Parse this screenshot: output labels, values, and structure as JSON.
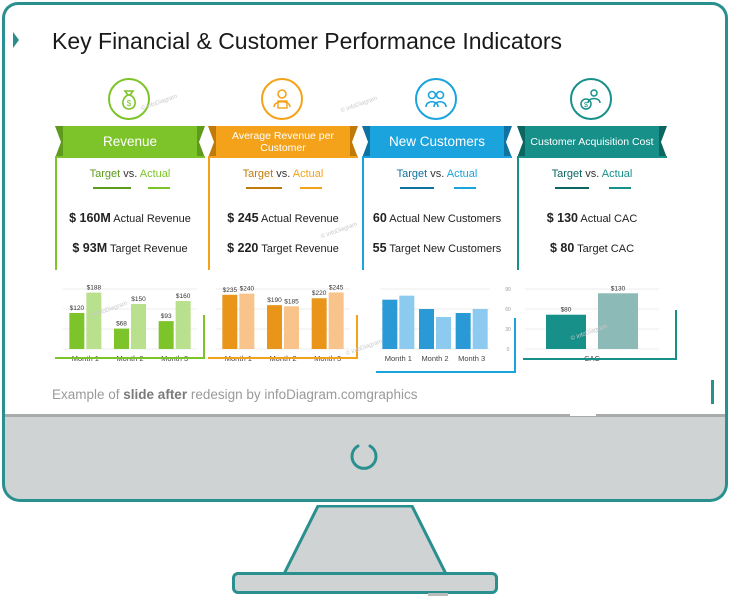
{
  "slide": {
    "title": "Key Financial & Customer Performance Indicators",
    "footer_prefix": "Example of ",
    "footer_bold": "slide after",
    "footer_suffix": " redesign by infoDiagram.com",
    "footer_tail": "graphics",
    "watermark": "© infoDiagram"
  },
  "colors": {
    "revenue": "#7dc42a",
    "arpc": "#f4a21a",
    "customers": "#1aa3dd",
    "cac": "#17908a",
    "frame": "#2a8f8f"
  },
  "columns": [
    {
      "label": "Revenue",
      "icon": "money-bag-icon",
      "target_text": "Target",
      "vs_text": "vs.",
      "actual_text": "Actual",
      "metric1_value": "$ 160M",
      "metric1_label": " Actual Revenue",
      "metric2_value": "$ 93M",
      "metric2_label": " Target  Revenue"
    },
    {
      "label": "Average Revenue per Customer",
      "icon": "customer-revenue-icon",
      "target_text": "Target",
      "vs_text": "vs.",
      "actual_text": "Actual",
      "metric1_value": "$ 245",
      "metric1_label": " Actual Revenue",
      "metric2_value": "$ 220",
      "metric2_label": " Target  Revenue"
    },
    {
      "label": "New Customers",
      "icon": "people-icon",
      "target_text": "Target",
      "vs_text": "vs.",
      "actual_text": "Actual",
      "metric1_value": "60",
      "metric1_label": " Actual New Customers",
      "metric2_value": "55",
      "metric2_label": " Target  New Customers"
    },
    {
      "label": "Customer Acquisition Cost",
      "icon": "acquisition-cost-icon",
      "target_text": "Target",
      "vs_text": "vs.",
      "actual_text": "Actual",
      "metric1_value": "$ 130",
      "metric1_label": " Actual CAC",
      "metric2_value": "$ 80",
      "metric2_label": " Target CAC"
    }
  ],
  "chart_data": [
    {
      "type": "bar",
      "categories": [
        "Month 1",
        "Month 2",
        "Month 3"
      ],
      "series": [
        {
          "values": [
            120,
            68,
            93
          ],
          "color": "#7dc42a"
        },
        {
          "values": [
            188,
            150,
            160
          ],
          "color": "#b9e08c"
        }
      ],
      "data_labels": [
        [
          "$120",
          "$68",
          "$93"
        ],
        [
          "$188",
          "$150",
          "$160"
        ]
      ],
      "ylim": [
        0,
        200
      ]
    },
    {
      "type": "bar",
      "categories": [
        "Month 1",
        "Month 2",
        "Month 3"
      ],
      "series": [
        {
          "values": [
            235,
            190,
            220
          ],
          "color": "#e8951a"
        },
        {
          "values": [
            240,
            185,
            245
          ],
          "color": "#f8c48c"
        }
      ],
      "data_labels": [
        [
          "$235",
          "$190",
          "$220"
        ],
        [
          "$240",
          "$185",
          "$245"
        ]
      ],
      "ylim": [
        0,
        260
      ]
    },
    {
      "type": "bar",
      "categories": [
        "Month 1",
        "Month 2",
        "Month 3"
      ],
      "series": [
        {
          "values": [
            74,
            60,
            54
          ],
          "color": "#2a9ad6"
        },
        {
          "values": [
            80,
            48,
            60
          ],
          "color": "#8ccbef"
        }
      ],
      "yticks": [
        "90",
        "60",
        "30",
        "0"
      ],
      "ylim": [
        0,
        90
      ]
    },
    {
      "type": "bar",
      "categories": [
        "CAC"
      ],
      "series": [
        {
          "values": [
            80
          ],
          "color": "#17908a"
        },
        {
          "values": [
            130
          ],
          "color": "#8cbab6"
        }
      ],
      "data_labels": [
        [
          "$80"
        ],
        [
          "$130"
        ]
      ],
      "ylim": [
        0,
        140
      ]
    }
  ]
}
